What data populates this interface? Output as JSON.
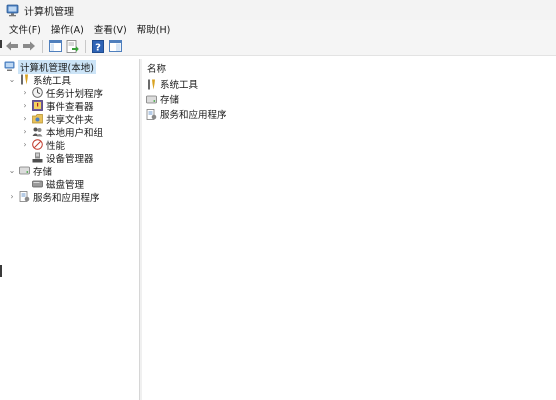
{
  "window": {
    "title": "计算机管理"
  },
  "menu": [
    {
      "id": "file",
      "label": "文件(F)"
    },
    {
      "id": "action",
      "label": "操作(A)"
    },
    {
      "id": "view",
      "label": "查看(V)"
    },
    {
      "id": "help",
      "label": "帮助(H)"
    }
  ],
  "toolbar": {
    "buttons": [
      "back-arrow-icon",
      "forward-arrow-icon",
      "show-tree-icon",
      "export-list-icon",
      "help-icon",
      "properties-icon"
    ]
  },
  "tree": {
    "root": {
      "label": "计算机管理(本地)"
    },
    "system_tools": {
      "label": "系统工具",
      "children": [
        {
          "label": "任务计划程序",
          "icon": "clock-icon"
        },
        {
          "label": "事件查看器",
          "icon": "event-viewer-icon"
        },
        {
          "label": "共享文件夹",
          "icon": "shared-folder-icon"
        },
        {
          "label": "本地用户和组",
          "icon": "users-icon"
        },
        {
          "label": "性能",
          "icon": "performance-icon"
        },
        {
          "label": "设备管理器",
          "icon": "device-manager-icon"
        }
      ]
    },
    "storage": {
      "label": "存储",
      "children": [
        {
          "label": "磁盘管理",
          "icon": "disk-icon"
        }
      ]
    },
    "services": {
      "label": "服务和应用程序"
    }
  },
  "content": {
    "column_name": "名称",
    "items": [
      {
        "label": "系统工具",
        "icon": "tools-icon"
      },
      {
        "label": "存储",
        "icon": "storage-icon"
      },
      {
        "label": "服务和应用程序",
        "icon": "services-icon"
      }
    ]
  }
}
